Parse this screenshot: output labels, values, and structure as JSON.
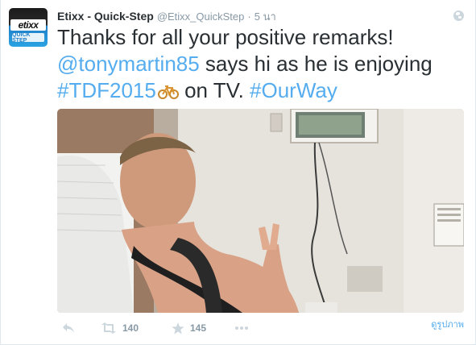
{
  "tweet": {
    "display_name": "Etixx - Quick-Step",
    "handle": "@Etixx_QuickStep",
    "separator": "·",
    "time": "5 นา",
    "text_line1": "Thanks for all your positive remarks!",
    "mention": "@tonymartin85",
    "text_line2_rest": " says hi as he is enjoying",
    "hashtag1": "#TDF2015",
    "text_line3_mid": " on TV. ",
    "hashtag2": "#OurWay"
  },
  "avatar": {
    "brand_text": "etixx",
    "brand_sub": "QUICK STEP"
  },
  "actions": {
    "reply_icon": "reply-icon",
    "retweet_count": "140",
    "favorite_count": "145",
    "more_icon": "more-dots-icon"
  },
  "view_photo_label": "ดูรูปภาพ",
  "colors": {
    "link": "#55acee",
    "text": "#292f33",
    "muted": "#8899a6",
    "icon": "#ccd6dd"
  }
}
